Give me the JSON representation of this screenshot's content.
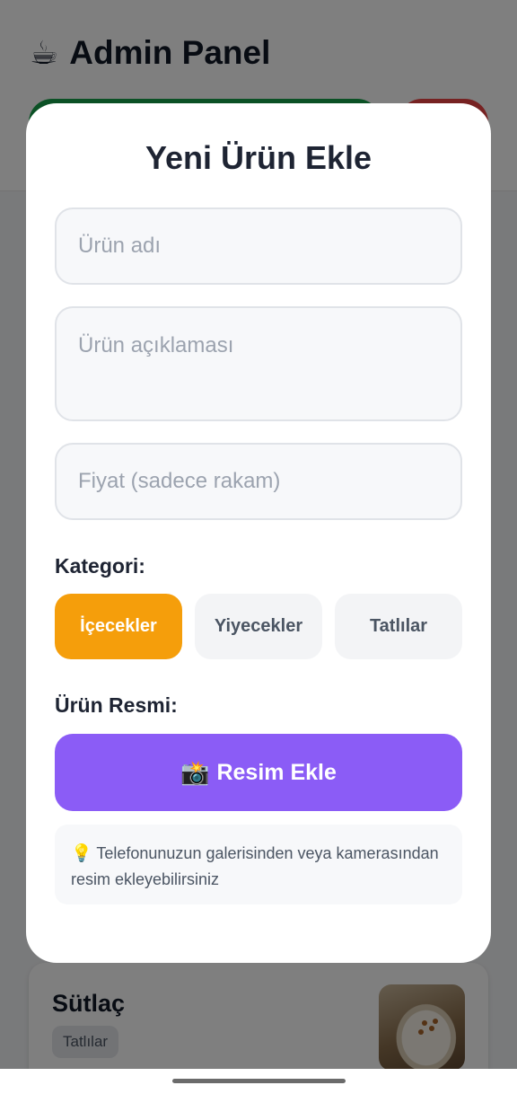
{
  "header": {
    "icon": "coffee-icon",
    "title": "Admin Panel",
    "colors": {
      "left_button": "#16a34a",
      "right_button": "#ef4444"
    }
  },
  "product_card": {
    "name": "Sütlaç",
    "category": "Tatlılar"
  },
  "modal": {
    "title": "Yeni Ürün Ekle",
    "name_field": {
      "placeholder": "Ürün adı",
      "value": ""
    },
    "description_field": {
      "placeholder": "Ürün açıklaması",
      "value": ""
    },
    "price_field": {
      "placeholder": "Fiyat (sadece rakam)",
      "value": ""
    },
    "category_label": "Kategori:",
    "categories": [
      {
        "label": "İçecekler",
        "selected": true
      },
      {
        "label": "Yiyecekler",
        "selected": false
      },
      {
        "label": "Tatlılar",
        "selected": false
      }
    ],
    "image_label": "Ürün Resmi:",
    "add_image_button": {
      "icon": "camera-flash-icon",
      "label": "Resim Ekle"
    },
    "hint": {
      "icon": "lightbulb-icon",
      "text": "Telefonunuzun galerisinden veya kamerasından resim ekleyebilirsiniz"
    },
    "colors": {
      "accent": "#f59e0b",
      "primary_button": "#8b5cf6"
    }
  }
}
